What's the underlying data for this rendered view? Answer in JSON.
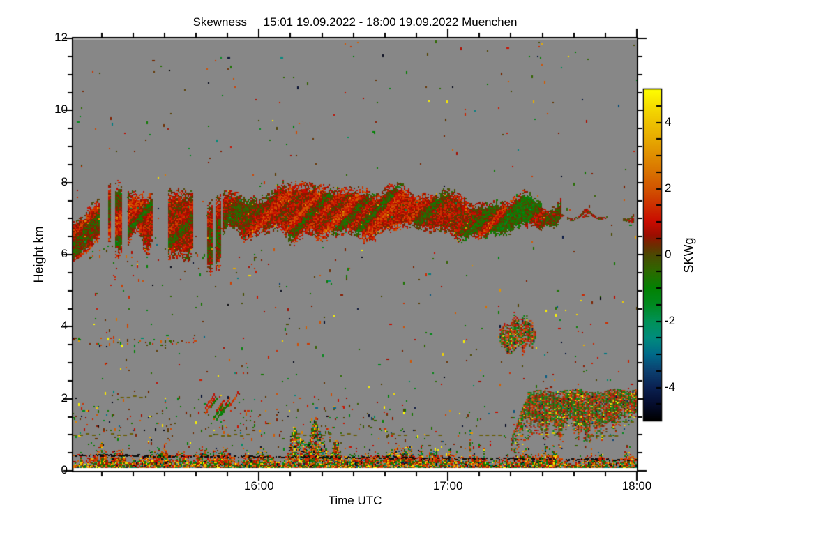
{
  "title": "Skewness     15:01 19.09.2022 - 18:00 19.09.2022 Muenchen",
  "site": "Muenchen",
  "date": "19.09.2022",
  "time_span": {
    "start": "15:01",
    "end": "18:00"
  },
  "plot_background": "#878787",
  "axes": {
    "x": {
      "label": "Time UTC",
      "start": "15:01",
      "end": "18:00",
      "major_ticks": [
        "16:00",
        "17:00",
        "18:00"
      ],
      "minor_tick_minutes": 10
    },
    "y": {
      "label": "Height km",
      "min": 0,
      "max": 12,
      "major_ticks": [
        12,
        10,
        8,
        6,
        4,
        2,
        0
      ],
      "minor_tick_km": 0.5
    }
  },
  "colorbar": {
    "label": "SKWg",
    "min": -5,
    "max": 5,
    "tick_labels": [
      4,
      2,
      0,
      -2,
      -4
    ],
    "minor_tick_step": 0.5,
    "colormap": [
      {
        "v": -5,
        "c": "#000000"
      },
      {
        "v": -4.5,
        "c": "#050d2e"
      },
      {
        "v": -4,
        "c": "#0a2152"
      },
      {
        "v": -3.5,
        "c": "#0c4070"
      },
      {
        "v": -3,
        "c": "#006a8a"
      },
      {
        "v": -2.5,
        "c": "#008c7d"
      },
      {
        "v": -2,
        "c": "#009257"
      },
      {
        "v": -1.5,
        "c": "#008a20"
      },
      {
        "v": -1,
        "c": "#038203"
      },
      {
        "v": -0.5,
        "c": "#2c6a00"
      },
      {
        "v": 0,
        "c": "#4c4a02"
      },
      {
        "v": 0.3,
        "c": "#6e2c00"
      },
      {
        "v": 0.6,
        "c": "#9c0e00"
      },
      {
        "v": 1,
        "c": "#c90b00"
      },
      {
        "v": 1.5,
        "c": "#cc3000"
      },
      {
        "v": 2,
        "c": "#d25400"
      },
      {
        "v": 2.5,
        "c": "#d97200"
      },
      {
        "v": 3,
        "c": "#e08e00"
      },
      {
        "v": 3.5,
        "c": "#e7aa00"
      },
      {
        "v": 4,
        "c": "#eec200"
      },
      {
        "v": 4.5,
        "c": "#f6de00"
      },
      {
        "v": 5,
        "c": "#ffff00"
      }
    ]
  },
  "chart_data": {
    "type": "heatmap",
    "title": "Skewness 15:01 19.09.2022 - 18:00 19.09.2022 Muenchen",
    "xlabel": "Time UTC",
    "ylabel": "Height km",
    "value_label": "SKWg",
    "x_range": [
      "15:01",
      "18:00"
    ],
    "y_range_km": [
      0,
      12
    ],
    "value_range": [
      -5,
      5
    ],
    "no_data_color": "#878787",
    "features": [
      {
        "kind": "speckle",
        "id": "background-speckle",
        "regions": [
          {
            "time": [
              "15:01",
              "18:00"
            ],
            "height_km": [
              0.0,
              12.0
            ],
            "count": 400
          },
          {
            "time": [
              "15:01",
              "18:00"
            ],
            "height_km": [
              0.6,
              1.7
            ],
            "count": 260
          },
          {
            "time": [
              "15:01",
              "16:50"
            ],
            "height_km": [
              1.0,
              2.15
            ],
            "count": 120
          },
          {
            "time": [
              "15:01",
              "15:40"
            ],
            "height_km": [
              3.45,
              3.7
            ],
            "count": 55
          },
          {
            "time": [
              "15:01",
              "16:10"
            ],
            "height_km": [
              5.6,
              6.3
            ],
            "count": 45
          },
          {
            "time": [
              "16:45",
              "18:00"
            ],
            "height_km": [
              2.3,
              4.9
            ],
            "count": 55
          },
          {
            "time": [
              "15:05",
              "16:30"
            ],
            "height_km": [
              2.0,
              6.0
            ],
            "count": 90
          }
        ]
      },
      {
        "kind": "dashes",
        "id": "dashed-olive-lines",
        "default_color": "#6a5f0a",
        "segments": [
          {
            "time": [
              "15:01",
              "15:19"
            ],
            "height_km": 1.0
          },
          {
            "time": [
              "15:44",
              "15:56"
            ],
            "height_km": 0.97
          },
          {
            "time": [
              "16:10",
              "16:22"
            ],
            "height_km": 1.0
          },
          {
            "time": [
              "16:26",
              "16:31"
            ],
            "height_km": 1.0
          },
          {
            "time": [
              "16:42",
              "16:47"
            ],
            "height_km": 1.0
          },
          {
            "time": [
              "16:53",
              "16:57"
            ],
            "height_km": 1.0
          },
          {
            "time": [
              "17:10",
              "17:16"
            ],
            "height_km": 1.0
          },
          {
            "time": [
              "15:16",
              "15:22"
            ],
            "height_km": 2.05
          },
          {
            "time": [
              "17:29",
              "17:34"
            ],
            "height_km": 1.02,
            "color": "#d6c800"
          },
          {
            "time": [
              "17:44",
              "17:58"
            ],
            "height_km": 1.37
          },
          {
            "time": [
              "17:45",
              "17:54"
            ],
            "height_km": 0.97
          }
        ]
      },
      {
        "kind": "cells",
        "id": "small-cells",
        "time": [
          "15:43",
          "15:53"
        ],
        "height_km": [
          1.4,
          1.9
        ],
        "count": 9
      },
      {
        "kind": "bl_plume",
        "id": "boundary-plume",
        "time": [
          "16:09",
          "16:25"
        ],
        "height_km": [
          0.3,
          1.5
        ]
      },
      {
        "kind": "cloud",
        "id": "mid-level-cloud",
        "time": [
          "15:01",
          "17:36"
        ],
        "height_km": [
          6.2,
          8.05
        ],
        "broken_before": "15:48",
        "thin_after": "17:08",
        "mean_skw": 0.6
      },
      {
        "kind": "thin_line",
        "id": "cloud-tail",
        "time": [
          "17:33",
          "17:59"
        ],
        "height_km": [
          6.9,
          7.2
        ]
      },
      {
        "kind": "patch",
        "id": "elevated-patch",
        "time": [
          "17:16",
          "17:28"
        ],
        "height_km": [
          3.25,
          4.3
        ]
      },
      {
        "kind": "layer2",
        "id": "evening-layer",
        "time": [
          "17:20",
          "18:00"
        ],
        "height_km": [
          0.95,
          2.3
        ]
      },
      {
        "kind": "bl",
        "id": "boundary-layer",
        "time": [
          "15:01",
          "18:00"
        ],
        "height_km": [
          0.08,
          0.9
        ],
        "spikes_to_km": 1.6
      },
      {
        "kind": "dark_dots",
        "id": "surface-dark-line",
        "time": [
          "15:01",
          "18:00"
        ],
        "height_km": [
          0.28,
          0.46
        ]
      }
    ]
  }
}
